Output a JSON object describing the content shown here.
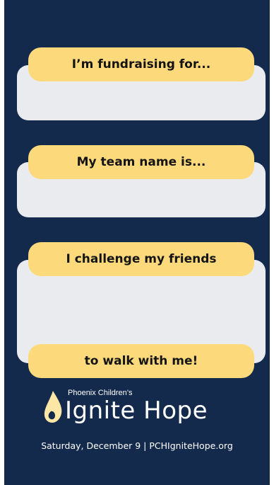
{
  "colors": {
    "background": "#132a4d",
    "pill": "#fcd97a",
    "panel": "#e9ebef",
    "text_dark": "#141414",
    "text_light": "#ffffff",
    "flame": "#fde7a6"
  },
  "prompts": {
    "fundraising": "I’m fundraising for...",
    "team": "My team name is...",
    "challenge": "I challenge my friends",
    "walk": "to walk with me!"
  },
  "brand": {
    "org": "Phoenix Children’s",
    "event": "Ignite Hope",
    "logo_icon": "flame-icon"
  },
  "footer": "Saturday, December 9 | PCHIgniteHope.org"
}
